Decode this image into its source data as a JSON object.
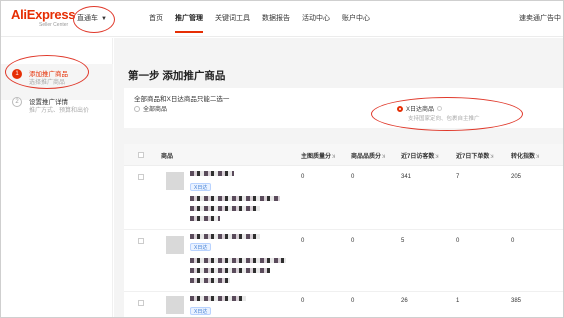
{
  "topbar": {
    "logo_text": "AliExpress",
    "logo_sub": "Seller Center",
    "product_selector": "直通车",
    "nav": [
      "首页",
      "推广管理",
      "关键词工具",
      "数据报告",
      "活动中心",
      "账户中心"
    ],
    "active_nav": "推广管理",
    "account": "速卖通广告中"
  },
  "steps": [
    {
      "num": "1",
      "title": "添加推广商品",
      "desc": "选择推广商品"
    },
    {
      "num": "2",
      "title": "设置推广详情",
      "desc": "推广方式、预算和出价"
    }
  ],
  "page_title": "第一步 添加推广商品",
  "choice": {
    "prompt": "全部商品和X日达商品只能二选一",
    "option_all": "全部商品",
    "option_xday": "X日达商品",
    "option_xday_hint": "支持国家定向、包裹自主推广"
  },
  "table": {
    "columns": [
      "商品",
      "主图质量分",
      "商品品质分",
      "近7日访客数",
      "近7日下单数",
      "转化指数"
    ],
    "sort_glyph": "ꓘ",
    "rows": [
      {
        "badge": "X日达",
        "title_partial": "",
        "quality": "0",
        "grade": "0",
        "visitors": "341",
        "orders": "7",
        "conversion": "205"
      },
      {
        "badge": "X日达",
        "title_partial": "",
        "quality": "0",
        "grade": "0",
        "visitors": "5",
        "orders": "0",
        "conversion": "0"
      },
      {
        "badge": "X日达",
        "title_partial": "",
        "quality": "0",
        "grade": "0",
        "visitors": "26",
        "orders": "1",
        "conversion": "385"
      }
    ]
  },
  "colors": {
    "accent": "#e62e04",
    "annotation": "#e0392b",
    "badge_blue": "#3a7bd5"
  }
}
